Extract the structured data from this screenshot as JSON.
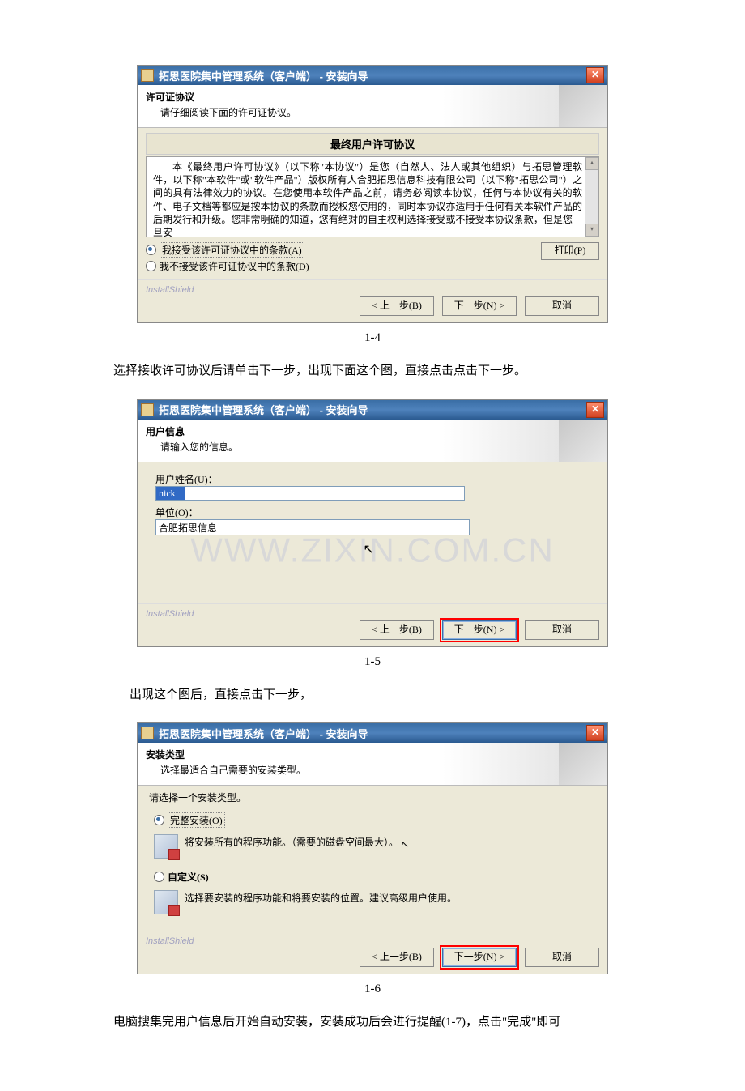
{
  "dialog_title": "拓思医院集中管理系统（客户端） - 安装向导",
  "close_x": "✕",
  "install_shield": "InstallShield",
  "buttons": {
    "back": "< 上一步(B)",
    "next": "下一步(N) >",
    "cancel": "取消",
    "print": "打印(P)"
  },
  "fig1": {
    "header_title": "许可证协议",
    "header_sub": "请仔细阅读下面的许可证协议。",
    "eula_heading": "最终用户许可协议",
    "eula_body": "本《最终用户许可协议》（以下称\"本协议\"）是您（自然人、法人或其他组织）与拓思管理软件，以下称\"本软件\"或\"软件产品\"）版权所有人合肥拓思信息科技有限公司（以下称\"拓思公司\"）之间的具有法律效力的协议。在您使用本软件产品之前，请务必阅读本协议，任何与本协议有关的软件、电子文档等都应是按本协议的条款而授权您使用的，同时本协议亦适用于任何有关本软件产品的后期发行和升级。您非常明确的知道，您有绝对的自主权利选择接受或不接受本协议条款，但是您一旦安",
    "radio_accept": "我接受该许可证协议中的条款(A)",
    "radio_decline": "我不接受该许可证协议中的条款(D)",
    "label": "1-4"
  },
  "para1": "选择接收许可协议后请单击下一步，出现下面这个图，直接点击点击下一步。",
  "fig2": {
    "header_title": "用户信息",
    "header_sub": "请输入您的信息。",
    "user_label": "用户姓名(U)：",
    "user_value": "nick",
    "org_label": "单位(O)：",
    "org_value": "合肥拓思信息",
    "watermark": "WWW.ZIXIN.COM.CN",
    "label": "1-5"
  },
  "para2": "出现这个图后，直接点击下一步，",
  "fig3": {
    "header_title": "安装类型",
    "header_sub": "选择最适合自己需要的安装类型。",
    "hint": "请选择一个安装类型。",
    "opt_complete": "完整安装(O)",
    "opt_complete_desc": "将安装所有的程序功能。（需要的磁盘空间最大）。",
    "opt_custom": "自定义(S)",
    "opt_custom_desc": "选择要安装的程序功能和将要安装的位置。建议高级用户使用。",
    "label": "1-6"
  },
  "para3": "电脑搜集完用户信息后开始自动安装，安装成功后会进行提醒(1-7)，点击\"完成\"即可"
}
